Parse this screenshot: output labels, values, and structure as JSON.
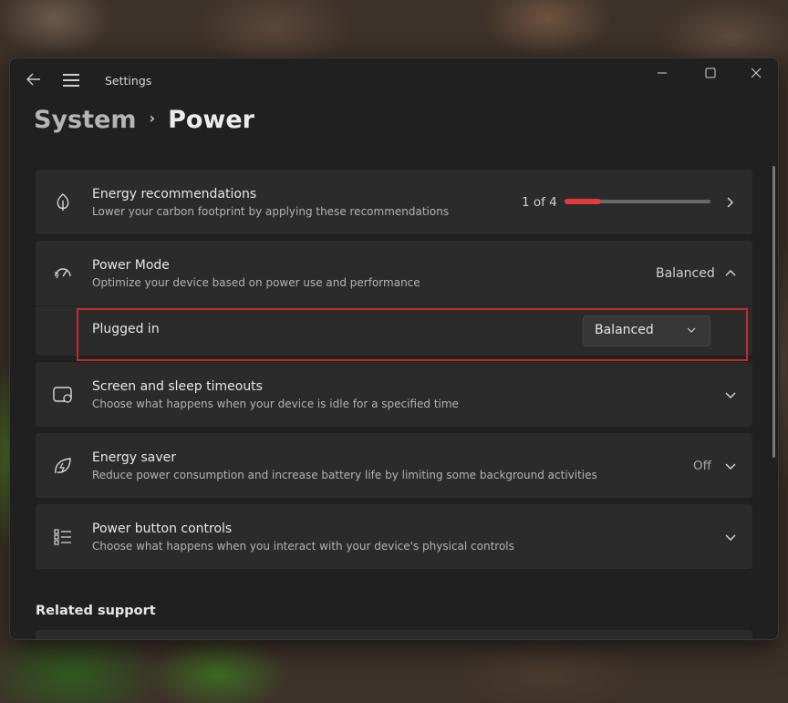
{
  "window": {
    "app_title": "Settings"
  },
  "breadcrumb": {
    "parent": "System",
    "separator": "›",
    "current": "Power"
  },
  "energy_recommendations": {
    "title": "Energy recommendations",
    "description": "Lower your carbon footprint by applying these recommendations",
    "progress_text": "1 of 4",
    "progress_fraction": 0.25,
    "icon": "leaf-icon"
  },
  "power_mode": {
    "title": "Power Mode",
    "description": "Optimize your device based on power use and performance",
    "value": "Balanced",
    "icon": "speedometer-icon",
    "plugged_in": {
      "label": "Plugged in",
      "selected": "Balanced"
    }
  },
  "screen_sleep": {
    "title": "Screen and sleep timeouts",
    "description": "Choose what happens when your device is idle for a specified time",
    "icon": "screen-sleep-icon"
  },
  "energy_saver": {
    "title": "Energy saver",
    "description": "Reduce power consumption and increase battery life by limiting some background activities",
    "value": "Off",
    "icon": "energy-saver-icon"
  },
  "power_button": {
    "title": "Power button controls",
    "description": "Choose what happens when you interact with your device's physical controls",
    "icon": "list-settings-icon"
  },
  "related_support": {
    "title": "Related support"
  },
  "colors": {
    "accent": "#e23a3a",
    "highlight_border": "#c42b2b",
    "card_bg": "#2b2b2b",
    "window_bg": "#202020"
  }
}
